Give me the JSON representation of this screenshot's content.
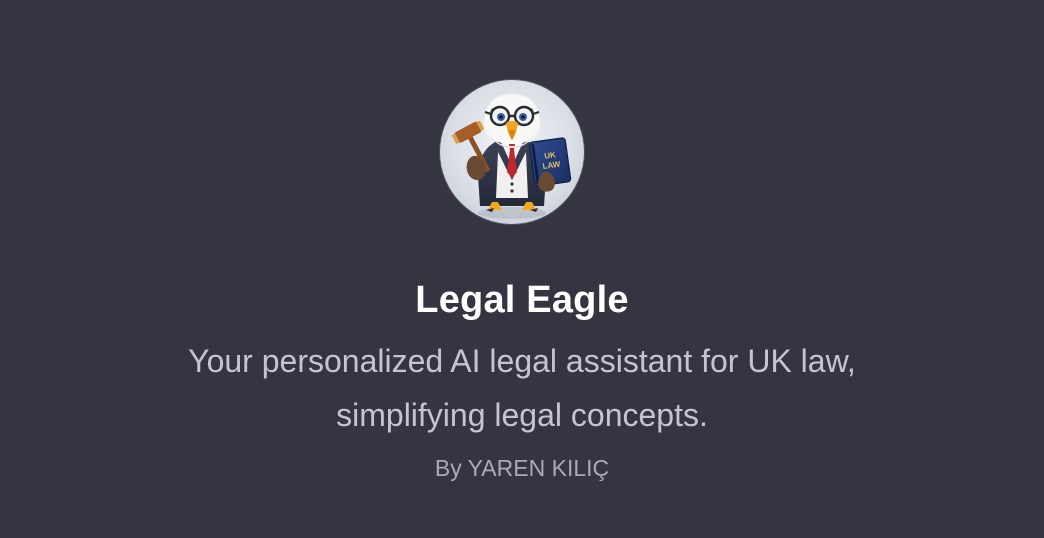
{
  "gpt": {
    "avatar_name": "legal-eagle-avatar",
    "book_text": "UK LAW",
    "title": "Legal Eagle",
    "description_line_1": "Your personalized AI legal assistant for UK law,",
    "description_line_2": "simplifying legal concepts.",
    "author": "By YAREN KILIÇ"
  },
  "colors": {
    "background": "#343541",
    "title": "#ffffff",
    "description": "#c5c5d2",
    "author": "#a9a9b8"
  }
}
